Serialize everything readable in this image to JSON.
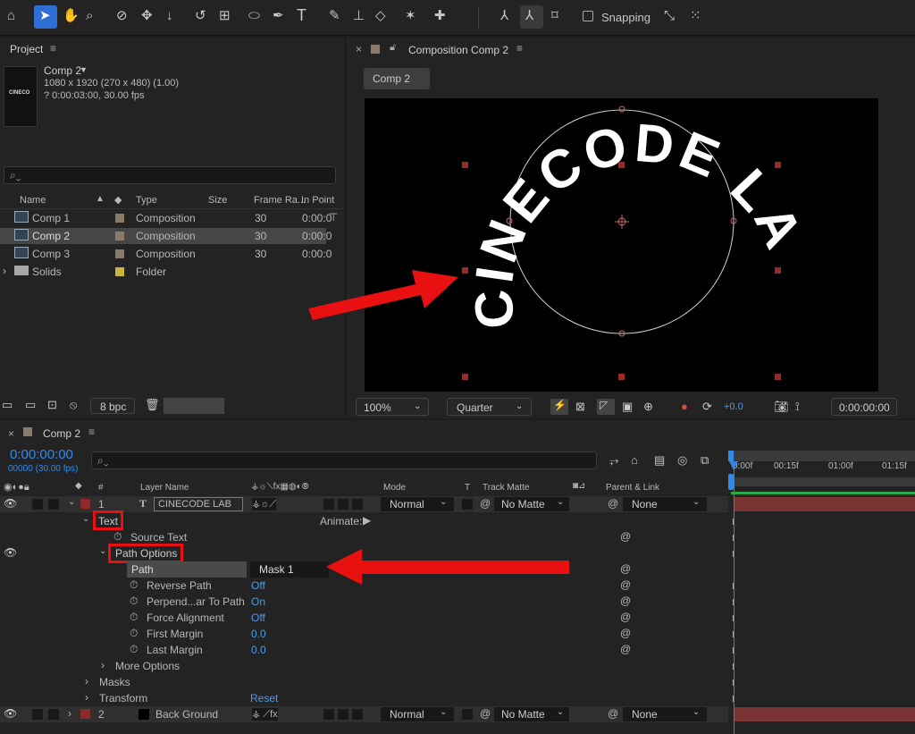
{
  "toolbar": {
    "snapping_label": "Snapping",
    "tools": [
      "home-icon",
      "selection-icon",
      "hand-icon",
      "zoom-icon",
      "orbit-icon",
      "pan-icon",
      "dolly-icon",
      "rotate-icon",
      "anchor-icon",
      "ellipse-icon",
      "pen-icon",
      "type-icon",
      "brush-icon",
      "stamp-icon",
      "eraser-icon",
      "puppet-icon",
      "pin-icon"
    ]
  },
  "project": {
    "title": "Project",
    "comp_name": "Comp 2",
    "comp_dims": "1080 x 1920  (270 x 480) (1.00)",
    "comp_duration": "? 0:00:03:00, 30.00 fps",
    "thumb_text": "CINECO",
    "columns": [
      "Name",
      "Type",
      "Size",
      "Frame Ra...",
      "In Point"
    ],
    "items": [
      {
        "name": "Comp 1",
        "type": "Composition",
        "fps": "30",
        "in": "0:00:0"
      },
      {
        "name": "Comp 2",
        "type": "Composition",
        "fps": "30",
        "in": "0:00:0"
      },
      {
        "name": "Comp 3",
        "type": "Composition",
        "fps": "30",
        "in": "0:00:0"
      },
      {
        "name": "Solids",
        "type": "Folder",
        "fps": "",
        "in": ""
      }
    ],
    "bpc": "8 bpc"
  },
  "viewer": {
    "title": "Composition Comp 2",
    "tab": "Comp 2",
    "text": "CINECODE LAB",
    "zoom": "100%",
    "resolution": "Quarter",
    "exposure": "+0.0",
    "timecode": "0:00:00:00"
  },
  "timeline": {
    "comp_tab": "Comp 2",
    "timecode": "0:00:00:00",
    "frame": "00000 (30.00 fps)",
    "headers": {
      "layer_name": "Layer Name",
      "mode": "Mode",
      "t": "T",
      "track_matte": "Track Matte",
      "parent": "Parent & Link"
    },
    "ruler": [
      "0:00f",
      "00:15f",
      "01:00f",
      "01:15f"
    ],
    "layer1": {
      "num": "1",
      "name": "CINECODE LAB",
      "mode": "Normal",
      "matte": "No Matte",
      "parent": "None"
    },
    "animate": "Animate:",
    "props": {
      "text": "Text",
      "source_text": "Source Text",
      "path_options": "Path Options",
      "path": "Path",
      "path_value": "Mask 1",
      "reverse": "Reverse Path",
      "reverse_val": "Off",
      "perp": "Perpend...ar To Path",
      "perp_val": "On",
      "force": "Force Alignment",
      "force_val": "Off",
      "first": "First Margin",
      "first_val": "0.0",
      "last": "Last Margin",
      "last_val": "0.0",
      "more": "More Options",
      "masks": "Masks",
      "transform": "Transform",
      "reset": "Reset"
    },
    "layer2": {
      "num": "2",
      "name": "Back Ground",
      "mode": "Normal",
      "matte": "No Matte",
      "parent": "None"
    }
  },
  "colors": {
    "accent": "#2d8ceb",
    "red_highlight": "#e81010",
    "label_red": "#8b2a2a"
  }
}
